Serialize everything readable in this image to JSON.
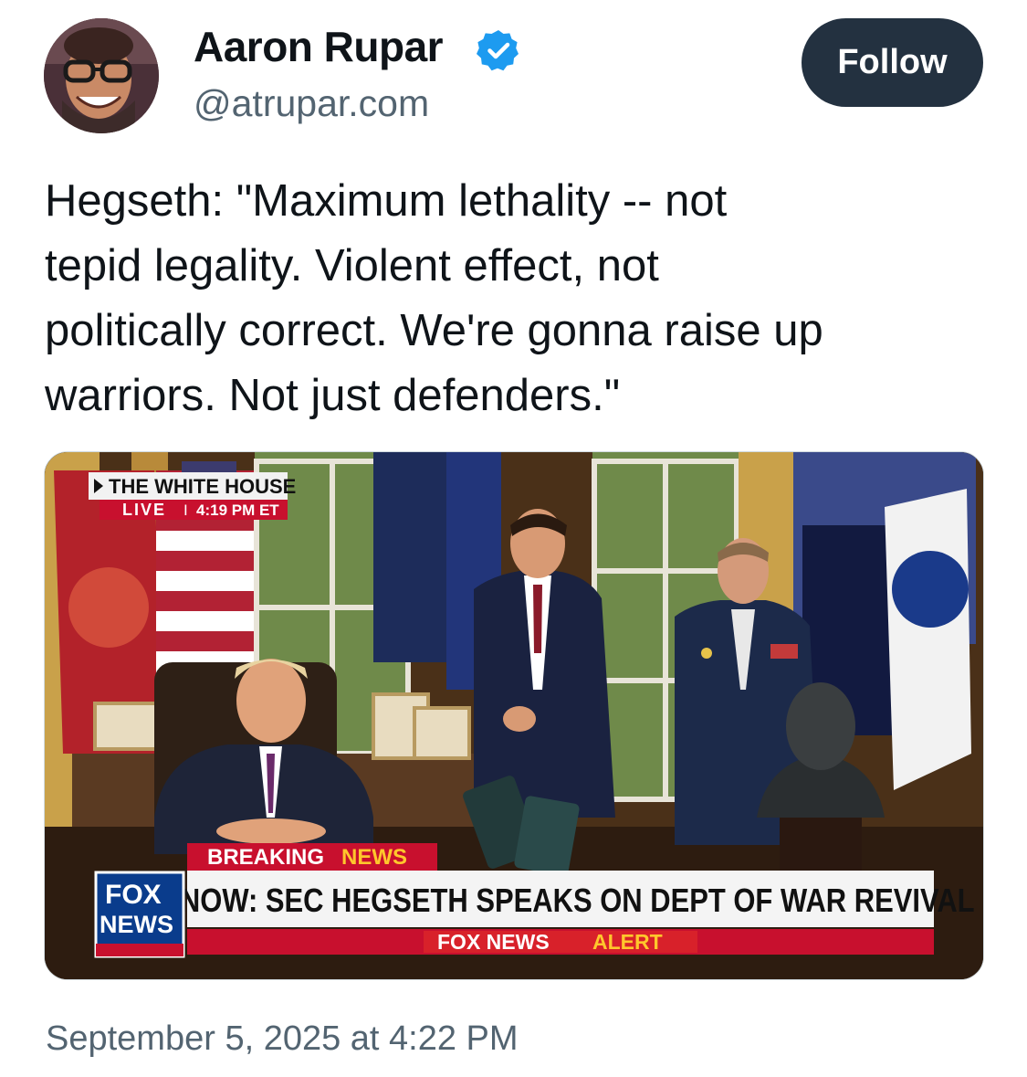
{
  "author": {
    "display_name": "Aaron Rupar",
    "handle": "@atrupar.com",
    "verified": true,
    "avatar_icon": "profile-photo"
  },
  "follow_button": {
    "label": "Follow"
  },
  "tweet": {
    "text": "Hegseth: \"Maximum lethality -- not\ntepid legality. Violent effect, not\npolitically correct. We're gonna raise up\nwarriors. Not just defenders.\"",
    "timestamp": "September 5, 2025 at 4:22 PM"
  },
  "media": {
    "bug_source": "THE WHITE HOUSE",
    "bug_live": "LIVE",
    "bug_time": "4:19 PM ET",
    "breaking_label_1": "BREAKING",
    "breaking_label_2": "NEWS",
    "headline": "NOW: SEC HEGSETH SPEAKS ON DEPT OF WAR REVIVAL",
    "alert_1": "FOX NEWS",
    "alert_2": "ALERT",
    "network_logo_1": "FOX",
    "network_logo_2": "NEWS"
  },
  "colors": {
    "follow_bg": "#233140",
    "verified_blue": "#1d9bf0",
    "secondary_text": "#536471",
    "breaking_red": "#c8102e",
    "news_yellow": "#ffc72c",
    "fox_blue": "#0a3c8c"
  }
}
